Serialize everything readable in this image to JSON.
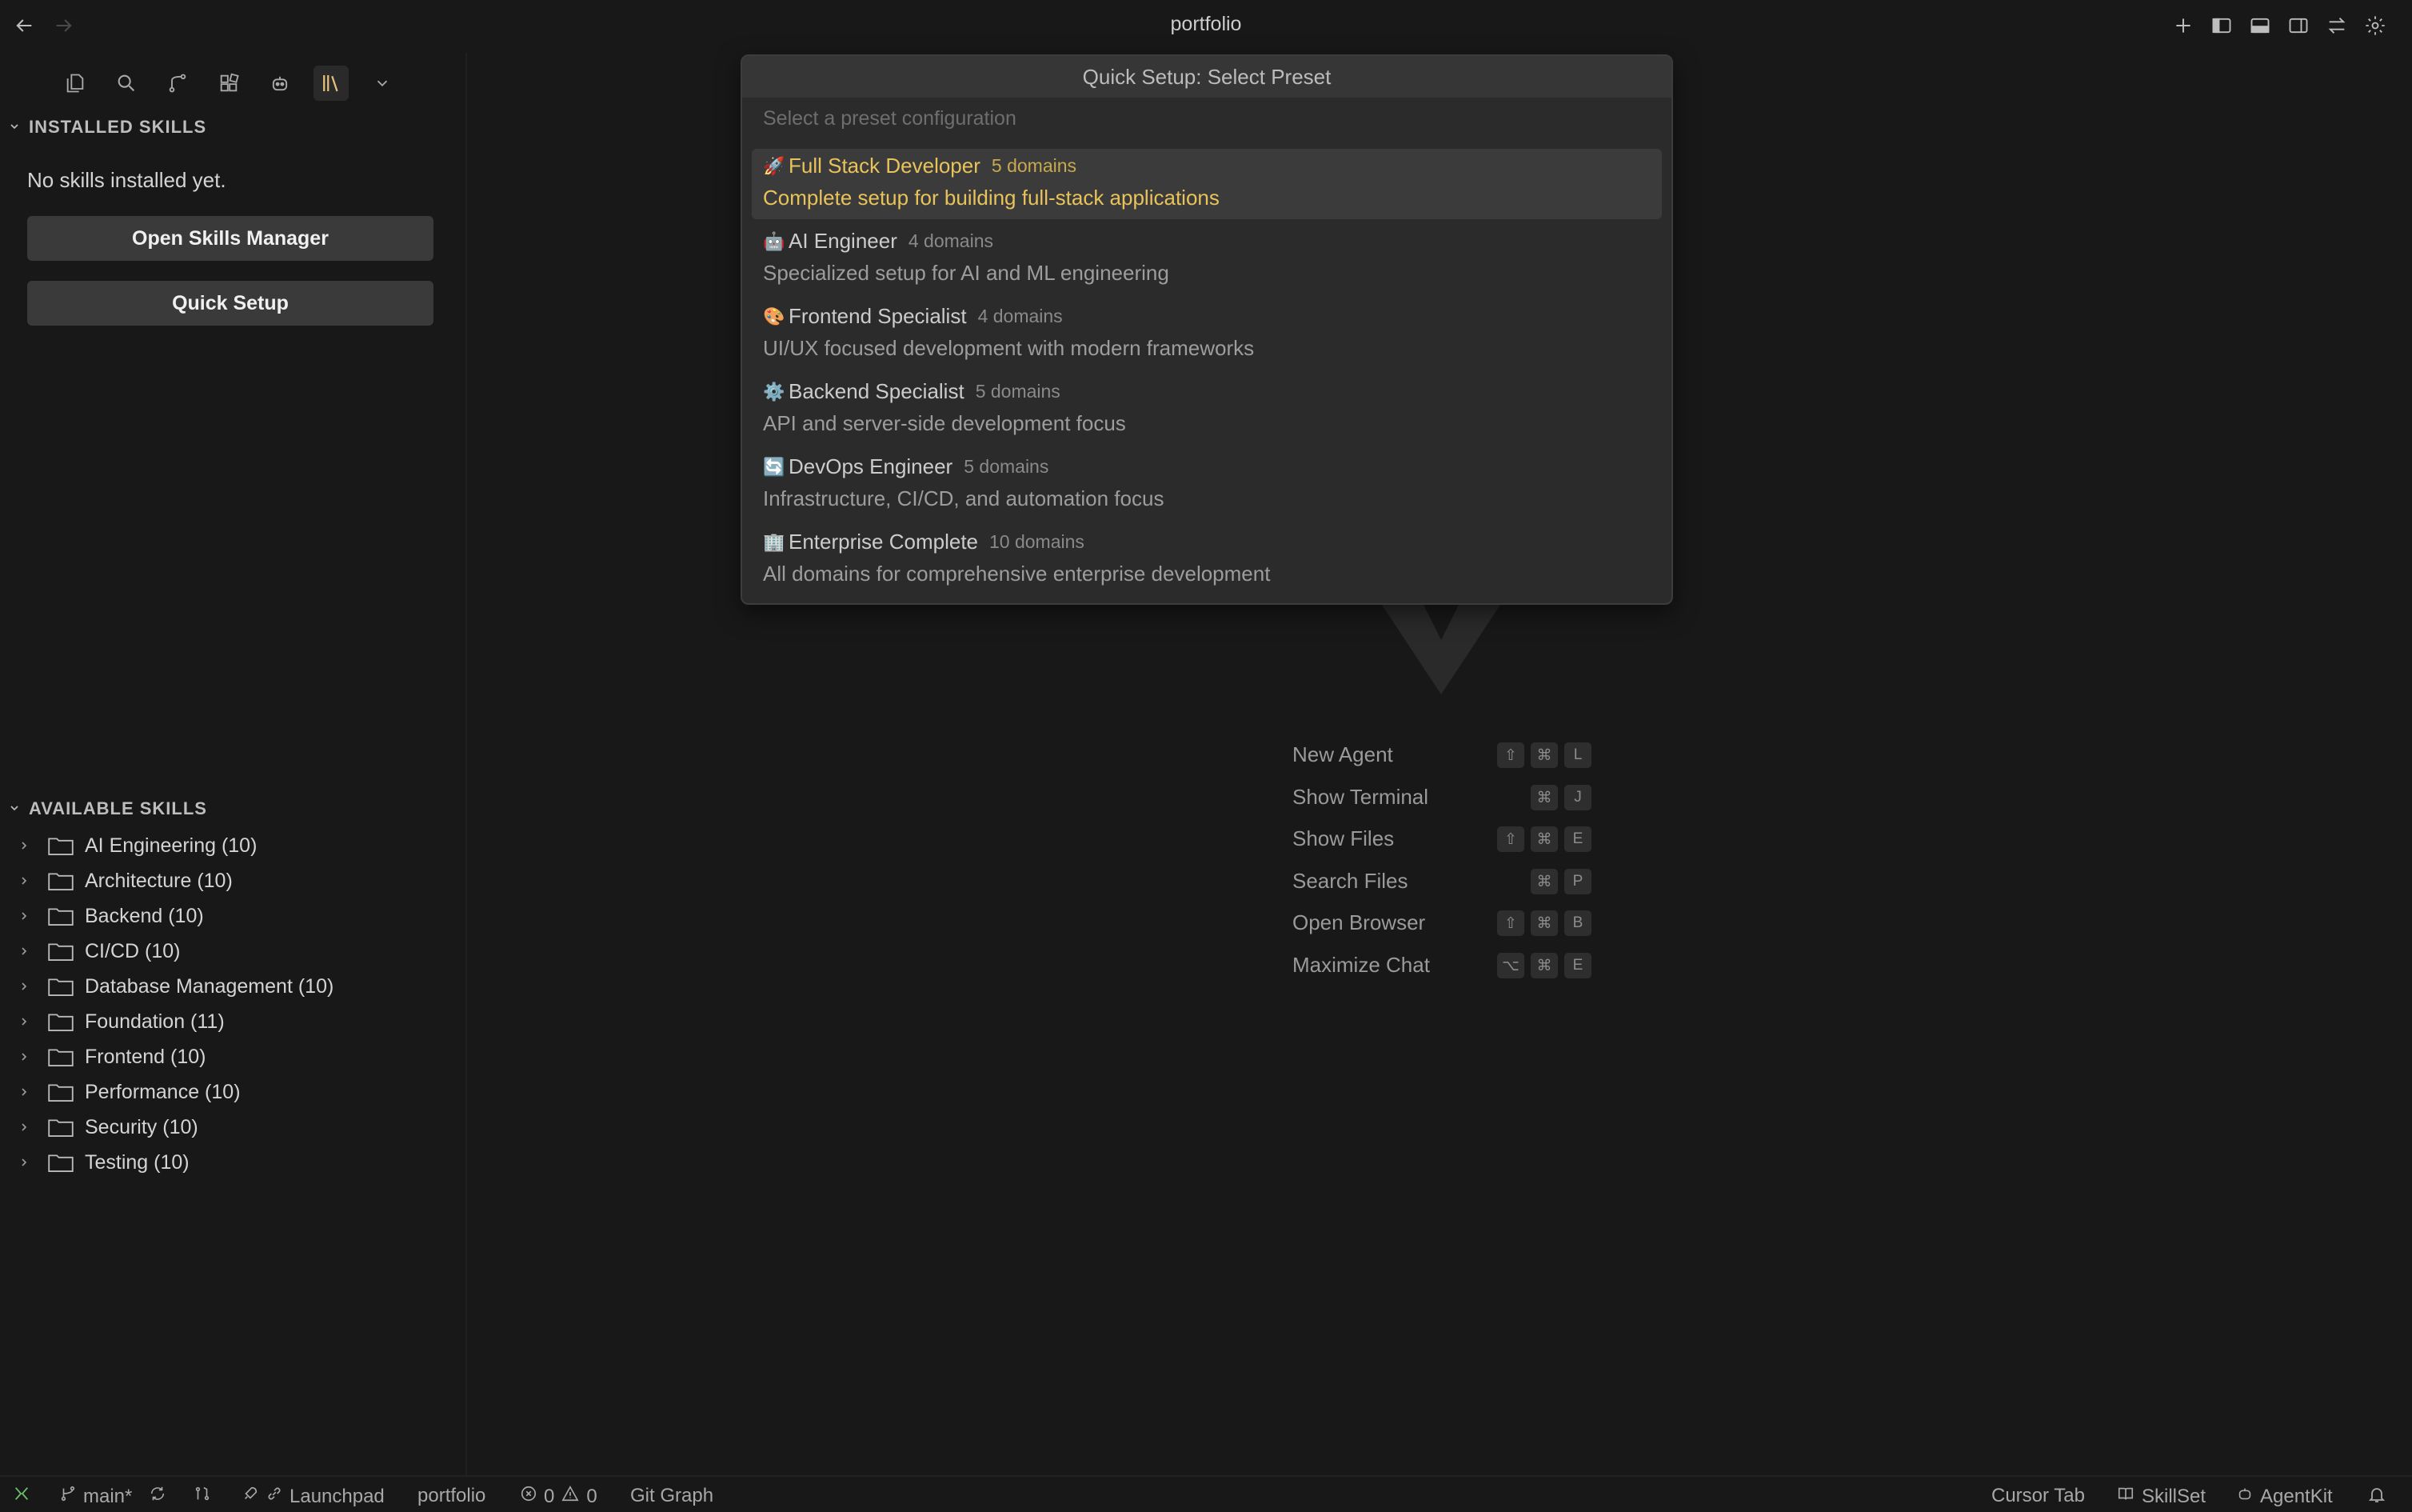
{
  "window": {
    "title": "portfolio"
  },
  "sidebar": {
    "installed_header": "INSTALLED SKILLS",
    "empty_message": "No skills installed yet.",
    "open_manager_label": "Open Skills Manager",
    "quick_setup_label": "Quick Setup",
    "available_header": "AVAILABLE SKILLS",
    "categories": [
      "AI Engineering (10)",
      "Architecture (10)",
      "Backend (10)",
      "CI/CD (10)",
      "Database Management (10)",
      "Foundation (11)",
      "Frontend (10)",
      "Performance (10)",
      "Security (10)",
      "Testing (10)"
    ]
  },
  "quick_pick": {
    "title": "Quick Setup: Select Preset",
    "placeholder": "Select a preset configuration",
    "items": [
      {
        "emoji": "🚀",
        "name": "Full Stack Developer",
        "domains": "5 domains",
        "description": "Complete setup for building full-stack applications"
      },
      {
        "emoji": "🤖",
        "name": "AI Engineer",
        "domains": "4 domains",
        "description": "Specialized setup for AI and ML engineering"
      },
      {
        "emoji": "🎨",
        "name": "Frontend Specialist",
        "domains": "4 domains",
        "description": "UI/UX focused development with modern frameworks"
      },
      {
        "emoji": "⚙️",
        "name": "Backend Specialist",
        "domains": "5 domains",
        "description": "API and server-side development focus"
      },
      {
        "emoji": "🔄",
        "name": "DevOps Engineer",
        "domains": "5 domains",
        "description": "Infrastructure, CI/CD, and automation focus"
      },
      {
        "emoji": "🏢",
        "name": "Enterprise Complete",
        "domains": "10 domains",
        "description": "All domains for comprehensive enterprise development"
      }
    ]
  },
  "shortcuts": [
    {
      "label": "New Agent",
      "keys": [
        "⇧",
        "⌘",
        "L"
      ]
    },
    {
      "label": "Show Terminal",
      "keys": [
        "⌘",
        "J"
      ]
    },
    {
      "label": "Show Files",
      "keys": [
        "⇧",
        "⌘",
        "E"
      ]
    },
    {
      "label": "Search Files",
      "keys": [
        "⌘",
        "P"
      ]
    },
    {
      "label": "Open Browser",
      "keys": [
        "⇧",
        "⌘",
        "B"
      ]
    },
    {
      "label": "Maximize Chat",
      "keys": [
        "⌥",
        "⌘",
        "E"
      ]
    }
  ],
  "statusbar": {
    "branch": "main*",
    "launchpad": "Launchpad",
    "workspace": "portfolio",
    "errors": "0",
    "warnings": "0",
    "git_graph": "Git Graph",
    "cursor_tab": "Cursor Tab",
    "skillset": "SkillSet",
    "agentkit": "AgentKit"
  }
}
